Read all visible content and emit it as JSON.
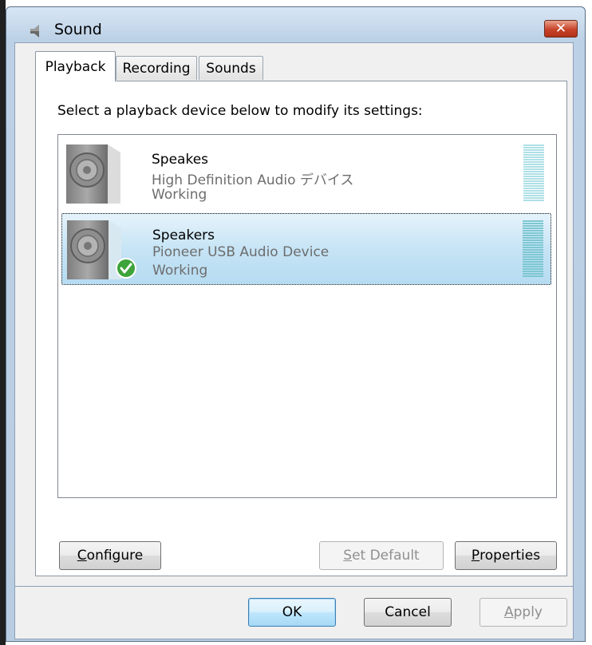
{
  "window": {
    "title": "Sound",
    "close_symbol": "✕"
  },
  "tabs": [
    {
      "label": "Playback",
      "active": true
    },
    {
      "label": "Recording",
      "active": false
    },
    {
      "label": "Sounds",
      "active": false
    }
  ],
  "instruction": "Select a playback device below to modify its settings:",
  "devices": [
    {
      "name": "Speakes",
      "description": "High Definition Audio デバイス",
      "status": "Working",
      "selected": false,
      "is_default": false,
      "icon": "speaker-icon"
    },
    {
      "name": "Speakers",
      "description": "Pioneer USB Audio Device",
      "status": "Working",
      "selected": true,
      "is_default": true,
      "icon": "speaker-icon"
    }
  ],
  "buttons": {
    "configure": {
      "mnemonic": "C",
      "rest": "onfigure"
    },
    "set_default": {
      "mnemonic": "S",
      "rest": "et Default",
      "enabled": false
    },
    "properties": {
      "mnemonic": "P",
      "rest": "roperties"
    },
    "ok": "OK",
    "cancel": "Cancel",
    "apply": {
      "mnemonic": "A",
      "rest": "pply",
      "enabled": false
    }
  },
  "colors": {
    "selection": "#c6e4f5",
    "meter": "#7cc7d2",
    "default_check": "#3da33a"
  }
}
